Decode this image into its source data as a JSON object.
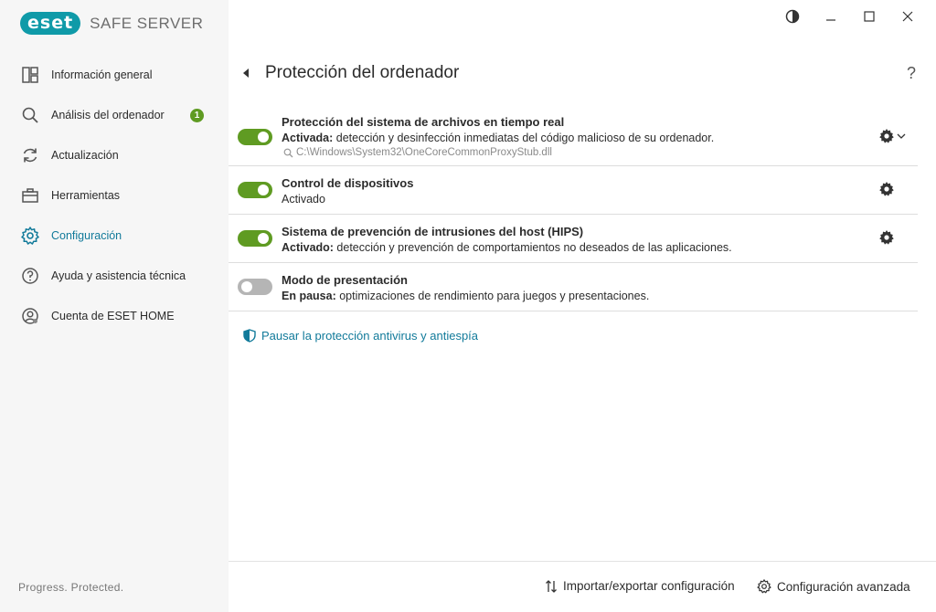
{
  "app": {
    "logo_badge": "eset",
    "logo_text": "SAFE SERVER",
    "footer": "Progress. Protected."
  },
  "sidebar": {
    "items": [
      {
        "label": "Información general",
        "icon": "dashboard-icon"
      },
      {
        "label": "Análisis del ordenador",
        "icon": "search-icon",
        "badge": "1"
      },
      {
        "label": "Actualización",
        "icon": "refresh-icon"
      },
      {
        "label": "Herramientas",
        "icon": "toolbox-icon"
      },
      {
        "label": "Configuración",
        "icon": "gear-icon",
        "active": true
      },
      {
        "label": "Ayuda y asistencia técnica",
        "icon": "help-icon"
      },
      {
        "label": "Cuenta de ESET HOME",
        "icon": "account-icon"
      }
    ]
  },
  "main": {
    "title": "Protección del ordenador",
    "help": "?",
    "rows": [
      {
        "title": "Protección del sistema de archivos en tiempo real",
        "status": "Activada:",
        "desc": " detección y desinfección inmediatas del código malicioso de su ordenador.",
        "path": "C:\\Windows\\System32\\OneCoreCommonProxyStub.dll",
        "enabled": true
      },
      {
        "title": "Control de dispositivos",
        "status": "Activado",
        "desc": "",
        "enabled": true
      },
      {
        "title": "Sistema de prevención de intrusiones del host (HIPS)",
        "status": "Activado:",
        "desc": " detección y prevención de comportamientos no deseados de las aplicaciones.",
        "enabled": true
      },
      {
        "title": "Modo de presentación",
        "status": "En pausa:",
        "desc": " optimizaciones de rendimiento para juegos y presentaciones.",
        "enabled": false
      }
    ],
    "pause_link": "Pausar la protección antivirus y antiespía",
    "import_export": "Importar/exportar configuración",
    "advanced": "Configuración avanzada"
  },
  "colors": {
    "accent": "#117a9a",
    "toggle_on": "#5f9b22",
    "toggle_off": "#b5b5b5",
    "brand": "#0f9aa8"
  }
}
